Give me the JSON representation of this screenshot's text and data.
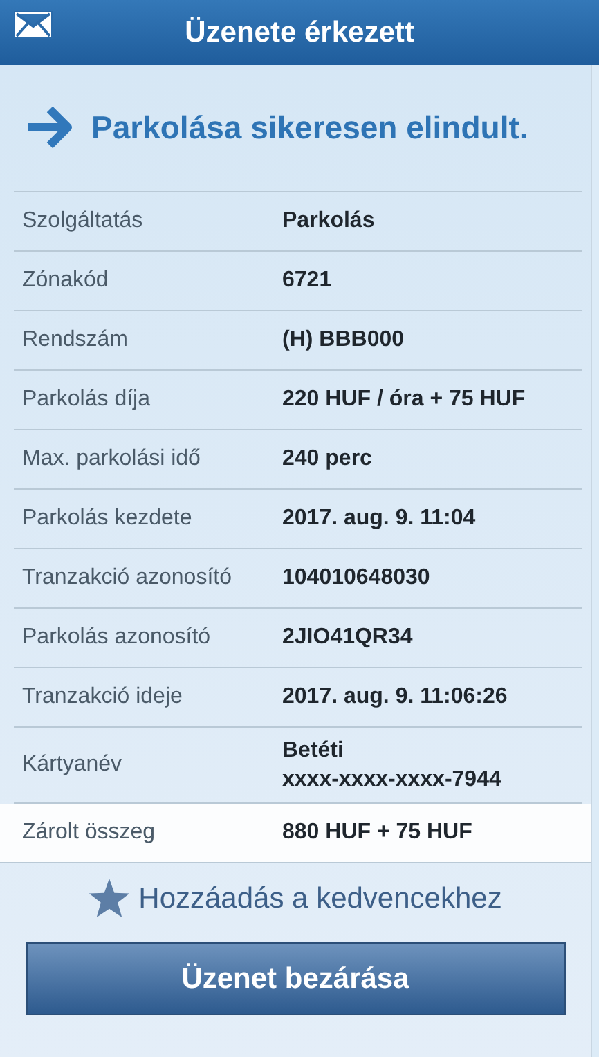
{
  "header": {
    "title": "Üzenete érkezett"
  },
  "message": "Parkolása sikeresen elindult.",
  "rows": [
    {
      "label": "Szolgáltatás",
      "lines": [
        "Parkolás"
      ],
      "selected": false
    },
    {
      "label": "Zónakód",
      "lines": [
        "6721"
      ],
      "selected": false
    },
    {
      "label": "Rendszám",
      "lines": [
        "(H) BBB000"
      ],
      "selected": false
    },
    {
      "label": "Parkolás díja",
      "lines": [
        "220 HUF / óra + 75 HUF"
      ],
      "selected": false
    },
    {
      "label": "Max. parkolási idő",
      "lines": [
        "240 perc"
      ],
      "selected": false
    },
    {
      "label": "Parkolás kezdete",
      "lines": [
        "2017. aug. 9. 11:04"
      ],
      "selected": false
    },
    {
      "label": "Tranzakció azonosító",
      "lines": [
        "104010648030"
      ],
      "selected": false
    },
    {
      "label": "Parkolás azonosító",
      "lines": [
        "2JIO41QR34"
      ],
      "selected": false
    },
    {
      "label": "Tranzakció ideje",
      "lines": [
        "2017. aug. 9. 11:06:26"
      ],
      "selected": false
    },
    {
      "label": "Kártyanév",
      "lines": [
        "Betéti",
        "xxxx-xxxx-xxxx-7944"
      ],
      "selected": false
    },
    {
      "label": "Zárolt összeg",
      "lines": [
        "880 HUF + 75 HUF"
      ],
      "selected": true
    }
  ],
  "favorite_link": "Hozzáadás a kedvencekhez",
  "close_button": "Üzenet bezárása"
}
